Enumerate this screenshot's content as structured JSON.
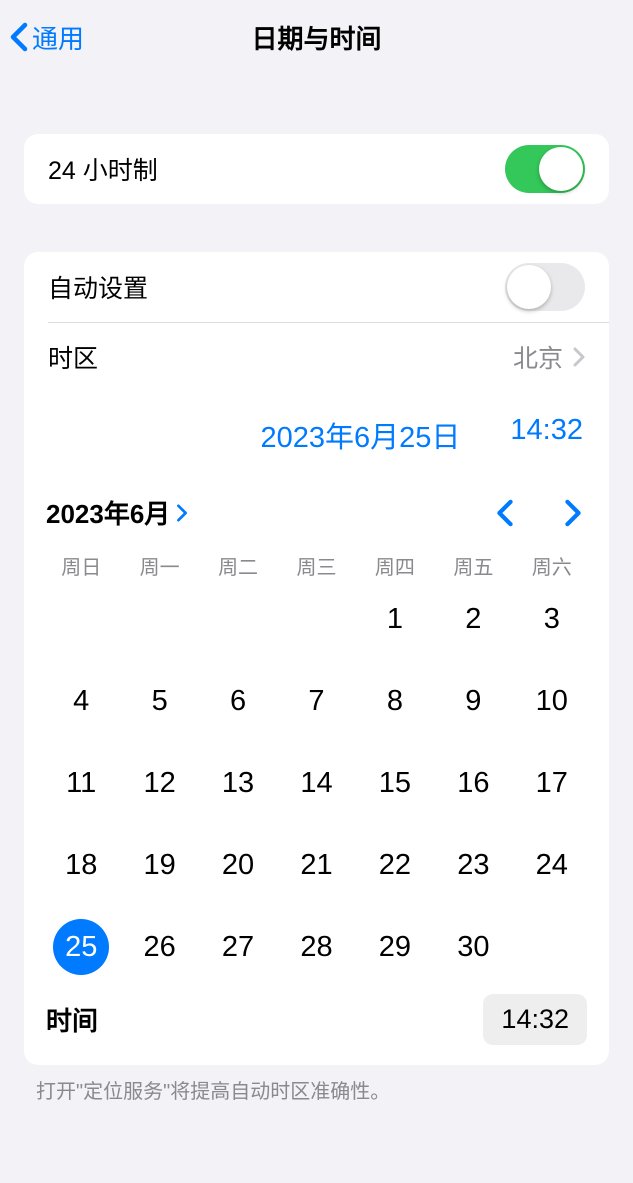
{
  "nav": {
    "back_label": "通用",
    "title": "日期与时间"
  },
  "section1": {
    "hour24_label": "24 小时制",
    "hour24_on": true
  },
  "section2": {
    "auto_set_label": "自动设置",
    "auto_set_on": false,
    "timezone_label": "时区",
    "timezone_value": "北京",
    "selected_date_display": "2023年6月25日",
    "selected_time_display": "14:32",
    "month_year_label": "2023年6月",
    "weekdays": [
      "周日",
      "周一",
      "周二",
      "周三",
      "周四",
      "周五",
      "周六"
    ],
    "leading_blanks": 4,
    "days_in_month": 30,
    "selected_day": 25,
    "time_label": "时间",
    "time_value": "14:32"
  },
  "footer": {
    "note": "打开\"定位服务\"将提高自动时区准确性。"
  }
}
